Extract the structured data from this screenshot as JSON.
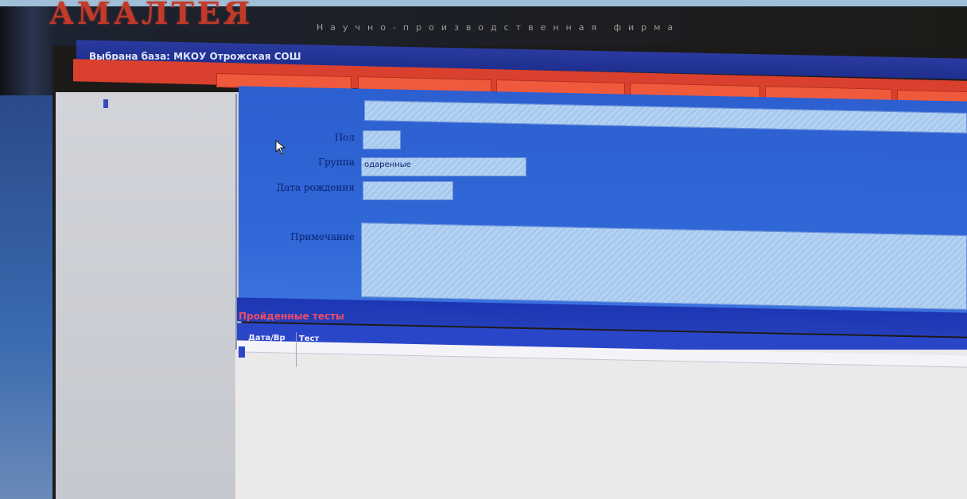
{
  "app": {
    "brand": "АМАЛТЕЯ",
    "tagline": "Научно-производственная фирма"
  },
  "db_bar": {
    "label": "Выбрана база: МКОУ Отрожская СОШ"
  },
  "sidebar": {
    "tree_root": "",
    "selected_item": ""
  },
  "form": {
    "fields": {
      "name_value": "",
      "gender_label": "Пол",
      "gender_value": "",
      "group_label": "Группа",
      "group_value": "одаренные",
      "birthdate_label": "Дата рождения",
      "birthdate_value": "",
      "notes_label": "Примечание",
      "notes_value": ""
    }
  },
  "tests": {
    "title": "Пройденные тесты",
    "columns": [
      "Дата/Вр",
      "Тест"
    ]
  },
  "colors": {
    "menu_red": "#d9412e",
    "form_blue": "#2d5fcf",
    "header_blue": "#1e2f8e",
    "title_pink": "#f04c64"
  }
}
